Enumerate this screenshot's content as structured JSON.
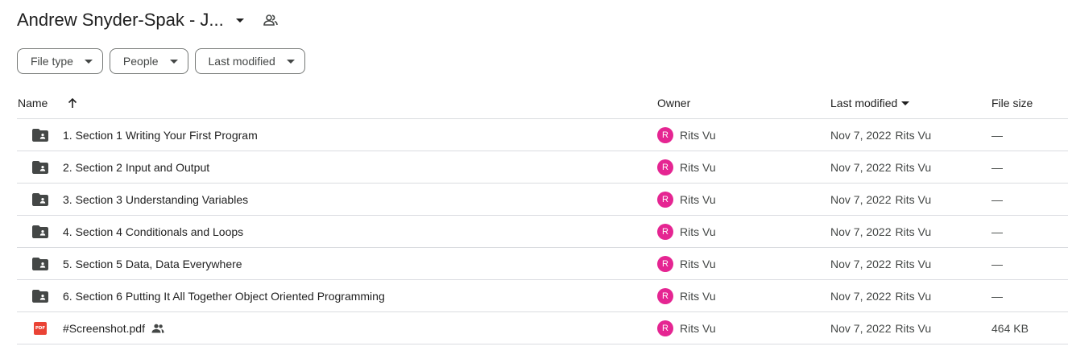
{
  "header": {
    "title": "Andrew Snyder-Spak - J...",
    "caret_icon": "arrow-drop-down-icon",
    "shared_icon": "people-outline-icon"
  },
  "filters": [
    {
      "label": "File type"
    },
    {
      "label": "People"
    },
    {
      "label": "Last modified"
    }
  ],
  "table": {
    "columns": {
      "name": "Name",
      "owner": "Owner",
      "modified": "Last modified",
      "size": "File size"
    },
    "sort_icon": "arrow-upward-icon",
    "rows": [
      {
        "type": "folder",
        "icon": "folder-icon",
        "name": "1. Section 1 Writing Your First Program",
        "owner_initial": "R",
        "owner": "Rits Vu",
        "modified_date": "Nov 7, 2022",
        "modified_by": "Rits Vu",
        "size": "—",
        "shared": false
      },
      {
        "type": "folder",
        "icon": "folder-icon",
        "name": "2. Section 2 Input and Output",
        "owner_initial": "R",
        "owner": "Rits Vu",
        "modified_date": "Nov 7, 2022",
        "modified_by": "Rits Vu",
        "size": "—",
        "shared": false
      },
      {
        "type": "folder",
        "icon": "folder-icon",
        "name": "3. Section 3 Understanding Variables",
        "owner_initial": "R",
        "owner": "Rits Vu",
        "modified_date": "Nov 7, 2022",
        "modified_by": "Rits Vu",
        "size": "—",
        "shared": false
      },
      {
        "type": "folder",
        "icon": "folder-icon",
        "name": "4. Section 4 Conditionals and Loops",
        "owner_initial": "R",
        "owner": "Rits Vu",
        "modified_date": "Nov 7, 2022",
        "modified_by": "Rits Vu",
        "size": "—",
        "shared": false
      },
      {
        "type": "folder",
        "icon": "folder-icon",
        "name": "5. Section 5 Data, Data Everywhere",
        "owner_initial": "R",
        "owner": "Rits Vu",
        "modified_date": "Nov 7, 2022",
        "modified_by": "Rits Vu",
        "size": "—",
        "shared": false
      },
      {
        "type": "folder",
        "icon": "folder-icon",
        "name": "6. Section 6 Putting It All Together Object Oriented Programming",
        "owner_initial": "R",
        "owner": "Rits Vu",
        "modified_date": "Nov 7, 2022",
        "modified_by": "Rits Vu",
        "size": "—",
        "shared": false
      },
      {
        "type": "pdf",
        "icon": "pdf-file-icon",
        "badge": "PDF",
        "name": "#Screenshot.pdf",
        "owner_initial": "R",
        "owner": "Rits Vu",
        "modified_date": "Nov 7, 2022",
        "modified_by": "Rits Vu",
        "size": "464 KB",
        "shared": true
      }
    ]
  },
  "colors": {
    "avatar": "#e52592",
    "pdf": "#ea4335",
    "folder": "#444746",
    "divider": "#dadce0"
  }
}
